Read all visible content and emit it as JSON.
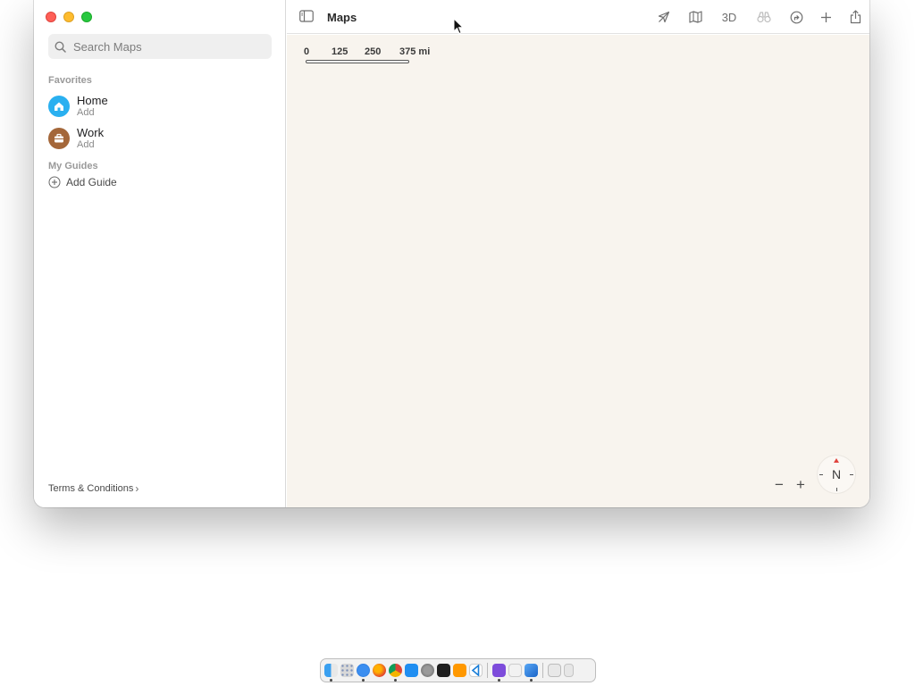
{
  "window": {
    "title": "Maps"
  },
  "sidebar": {
    "search_placeholder": "Search Maps",
    "favorites_label": "Favorites",
    "favorites": [
      {
        "title": "Home",
        "subtitle": "Add",
        "icon": "house-icon",
        "color": "#2ab0f0"
      },
      {
        "title": "Work",
        "subtitle": "Add",
        "icon": "briefcase-icon",
        "color": "#a4673a"
      }
    ],
    "guides_label": "My Guides",
    "add_guide_label": "Add Guide",
    "terms_label": "Terms & Conditions",
    "terms_chevron": "›"
  },
  "toolbar": {
    "three_d_label": "3D",
    "icons": [
      "location-arrow-icon",
      "map-icon",
      "3d-toggle",
      "binoculars-icon",
      "directions-icon",
      "add-icon",
      "share-icon",
      "account-icon"
    ]
  },
  "map": {
    "scale": {
      "labels": [
        "0",
        "125",
        "250",
        "375 mi"
      ]
    },
    "zoom_out_label": "−",
    "zoom_in_label": "+",
    "compass_label": "N",
    "background_color": "#f8f4ee"
  },
  "dock": {
    "apps": [
      "finder",
      "launchpad",
      "safari",
      "firefox",
      "chrome",
      "app-store",
      "system-settings",
      "terminal",
      "sublime-text",
      "vscode",
      "unknown-app-purple",
      "notes",
      "xcode",
      "preview",
      "trash"
    ]
  }
}
